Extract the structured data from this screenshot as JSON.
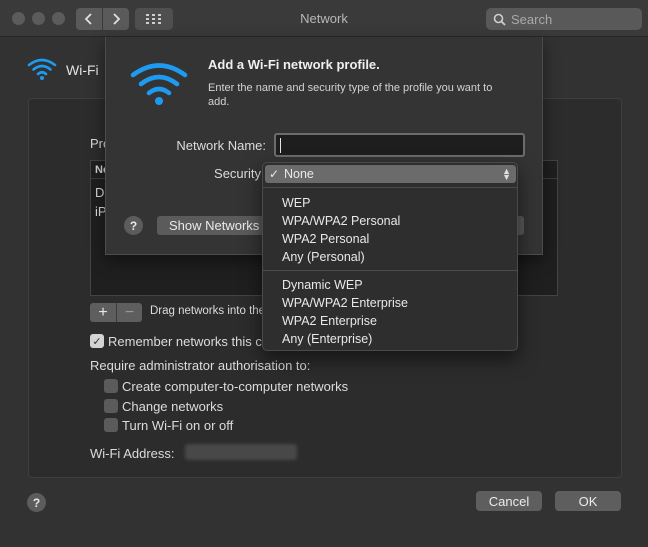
{
  "titlebar": {
    "title": "Network",
    "search_placeholder": "Search"
  },
  "pane": {
    "wifi_label": "Wi-Fi",
    "preferred_title": "Pro",
    "list_header": "Ne",
    "list_rows": [
      "Di",
      "iP"
    ],
    "drag_text": "Drag networks into the",
    "remember_label": "Remember networks this c",
    "require_admin": "Require administrator authorisation to:",
    "admin_options": [
      {
        "label": "Create computer-to-computer networks",
        "checked": false
      },
      {
        "label": "Change networks",
        "checked": false
      },
      {
        "label": "Turn Wi-Fi on or off",
        "checked": false
      }
    ],
    "wifi_address_label": "Wi-Fi Address:"
  },
  "footer": {
    "help": "?",
    "cancel": "Cancel",
    "ok": "OK"
  },
  "sheet": {
    "title": "Add a Wi-Fi network profile.",
    "subtitle": "Enter the name and security type of the profile you want to add.",
    "network_name_label": "Network Name:",
    "network_name_value": "",
    "security_label": "Security",
    "help": "?",
    "show_networks": "Show Networks"
  },
  "security_menu": {
    "selected": "None",
    "check": "✓",
    "groups": [
      [
        "None"
      ],
      [
        "WEP",
        "WPA/WPA2 Personal",
        "WPA2 Personal",
        "Any (Personal)"
      ],
      [
        "Dynamic WEP",
        "WPA/WPA2 Enterprise",
        "WPA2 Enterprise",
        "Any (Enterprise)"
      ]
    ]
  },
  "icons": {
    "wifi": "wifi-icon",
    "back": "chevron-left-icon",
    "forward": "chevron-right-icon",
    "grid": "grid-icon",
    "search": "search-icon"
  },
  "colors": {
    "background": "#323232",
    "accent_wifi": "#1e9bf0"
  }
}
